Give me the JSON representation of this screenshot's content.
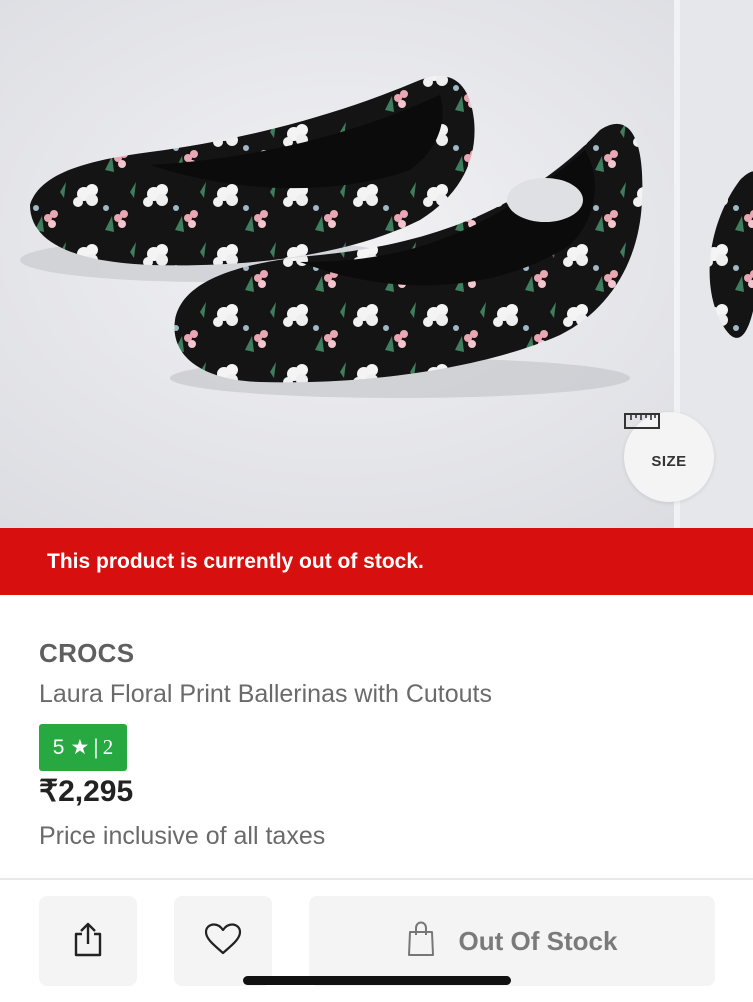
{
  "gallery": {
    "size_button_label": "SIZE"
  },
  "banner": {
    "text": "This product is currently out of stock."
  },
  "product": {
    "brand": "CROCS",
    "name": "Laura Floral Print Ballerinas with Cutouts",
    "rating_value": "5",
    "rating_star": "★",
    "rating_separator": "|",
    "rating_count": "2",
    "price": "₹2,295",
    "tax_note": "Price inclusive of all taxes"
  },
  "actions": {
    "out_of_stock_label": "Out Of Stock"
  },
  "colors": {
    "banner_bg": "#d7100f",
    "rating_bg": "#27a840",
    "button_bg": "#f4f4f4"
  }
}
